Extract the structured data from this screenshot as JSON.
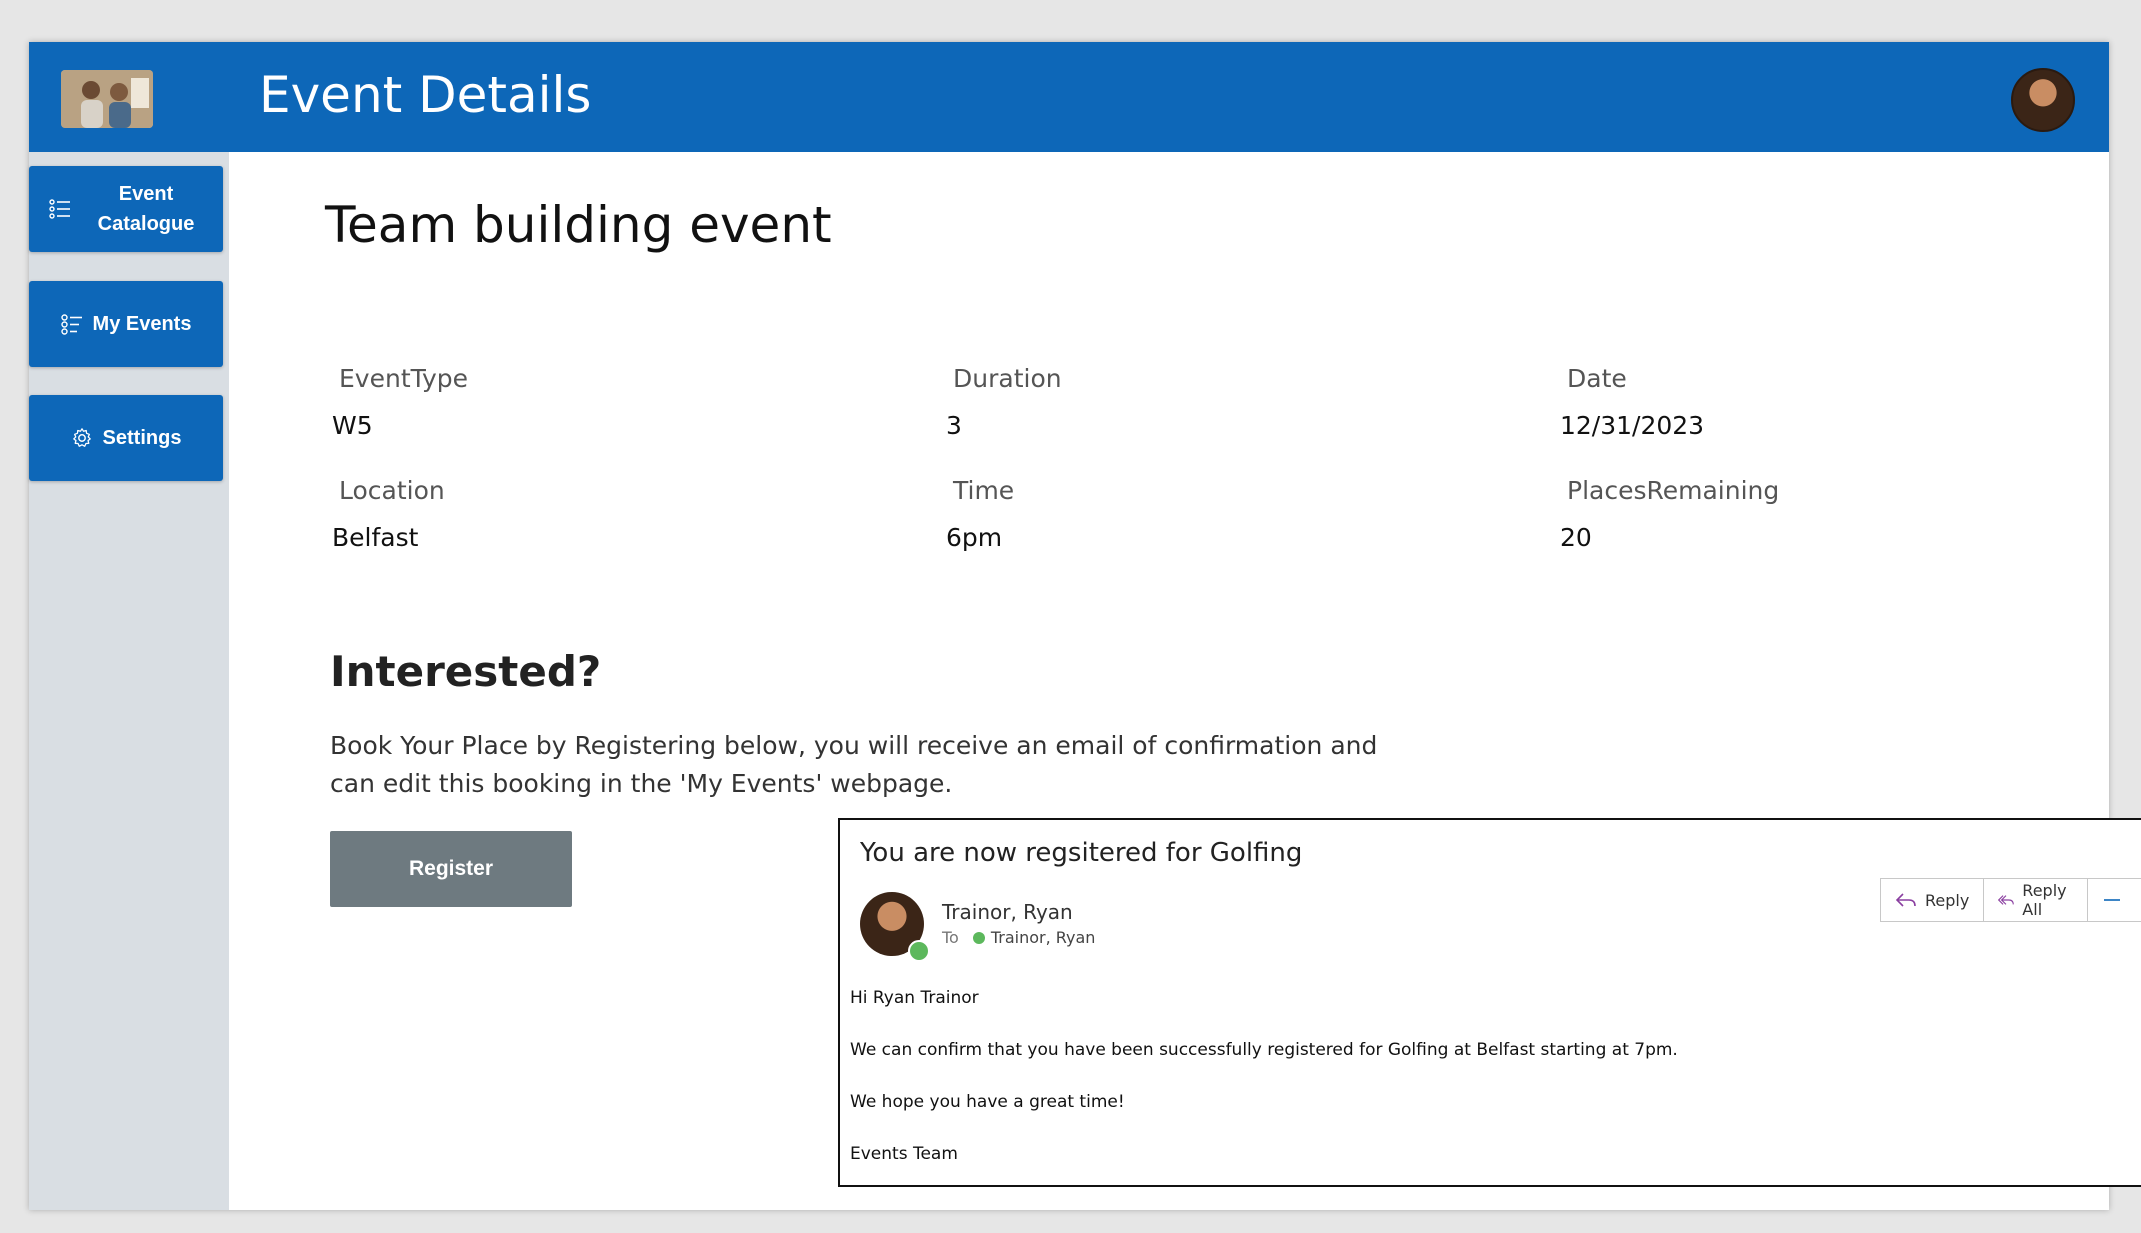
{
  "header": {
    "title": "Event Details",
    "logo_icon": "team-photo-logo",
    "avatar_icon": "user-avatar"
  },
  "sidebar": {
    "items": [
      {
        "label": "Event Catalogue",
        "icon": "list-icon"
      },
      {
        "label": "My Events",
        "icon": "checklist-icon"
      },
      {
        "label": "Settings",
        "icon": "gear-icon"
      }
    ]
  },
  "event": {
    "title": "Team building event",
    "fields": [
      {
        "label": "EventType",
        "value": "W5"
      },
      {
        "label": "Duration",
        "value": "3"
      },
      {
        "label": "Date",
        "value": "12/31/2023"
      },
      {
        "label": "Location",
        "value": "Belfast"
      },
      {
        "label": "Time",
        "value": "6pm"
      },
      {
        "label": "PlacesRemaining",
        "value": "20"
      }
    ]
  },
  "booking": {
    "heading": "Interested?",
    "description": "Book Your Place by Registering below, you will receive an email of confirmation and can edit this booking in the 'My Events' webpage.",
    "register_label": "Register"
  },
  "email": {
    "subject": "You are now regsitered for Golfing",
    "sender": "Trainor, Ryan",
    "to_label": "To",
    "recipient": "Trainor, Ryan",
    "actions": [
      "Reply",
      "Reply All"
    ],
    "body": [
      "Hi Ryan Trainor",
      "We can confirm that you have been successfully registered for Golfing at Belfast starting at 7pm.",
      "We hope you have a great time!",
      "Events Team"
    ],
    "colors": {
      "presence": "#5cb85c",
      "reply_icon": "#8a3fa0"
    }
  },
  "colors": {
    "brand": "#0d67b8",
    "sidebar_bg": "#d9dee3",
    "register_bg": "#6e7a80"
  }
}
